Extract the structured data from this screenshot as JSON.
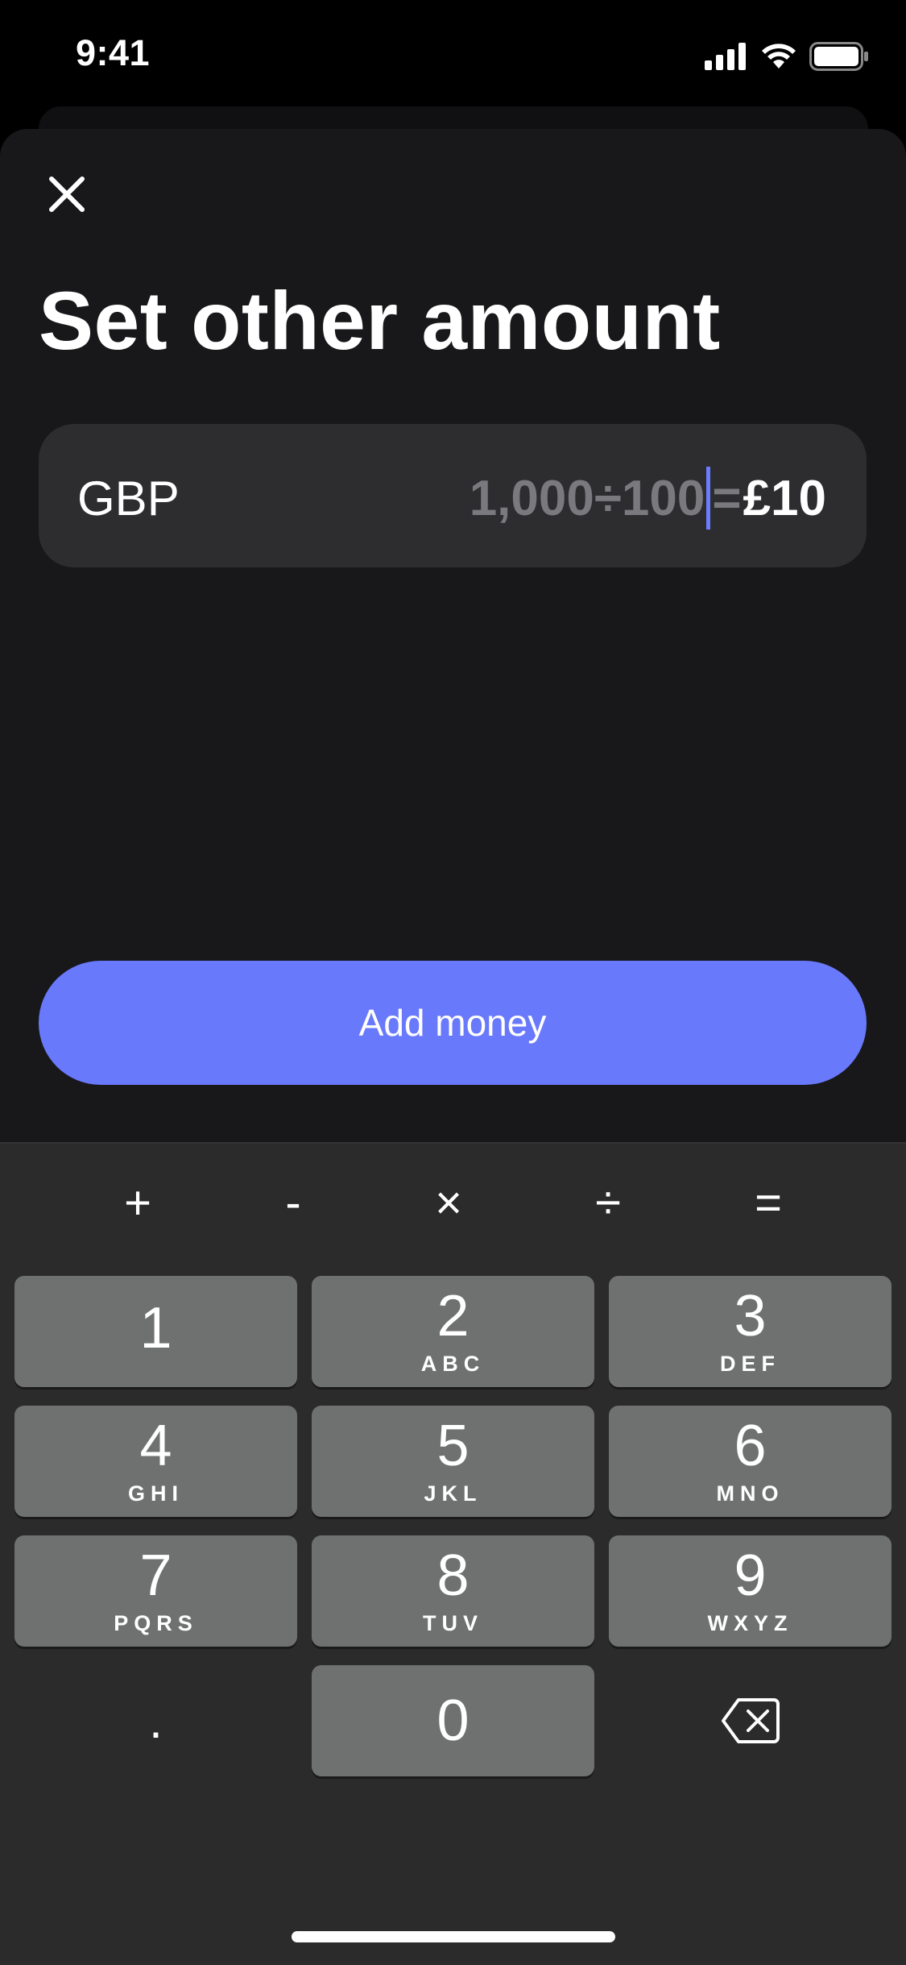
{
  "status_bar": {
    "time": "9:41"
  },
  "sheet": {
    "title": "Set other amount",
    "amount_field": {
      "currency": "GBP",
      "expression": "1,000÷100",
      "equals": "=",
      "result": "£10"
    },
    "primary_button": "Add money"
  },
  "keyboard": {
    "operators": [
      "+",
      "-",
      "×",
      "÷",
      "="
    ],
    "keys": [
      {
        "num": "1",
        "letters": ""
      },
      {
        "num": "2",
        "letters": "ABC"
      },
      {
        "num": "3",
        "letters": "DEF"
      },
      {
        "num": "4",
        "letters": "GHI"
      },
      {
        "num": "5",
        "letters": "JKL"
      },
      {
        "num": "6",
        "letters": "MNO"
      },
      {
        "num": "7",
        "letters": "PQRS"
      },
      {
        "num": "8",
        "letters": "TUV"
      },
      {
        "num": "9",
        "letters": "WXYZ"
      },
      {
        "num": "0",
        "letters": ""
      }
    ],
    "decimal": "."
  },
  "colors": {
    "accent": "#6979fb",
    "caret": "#6b7cff",
    "sheet_bg": "#18181a",
    "field_bg": "#2d2d30"
  },
  "icons": [
    "close-icon",
    "signal-icon",
    "wifi-icon",
    "battery-icon",
    "backspace-icon"
  ]
}
